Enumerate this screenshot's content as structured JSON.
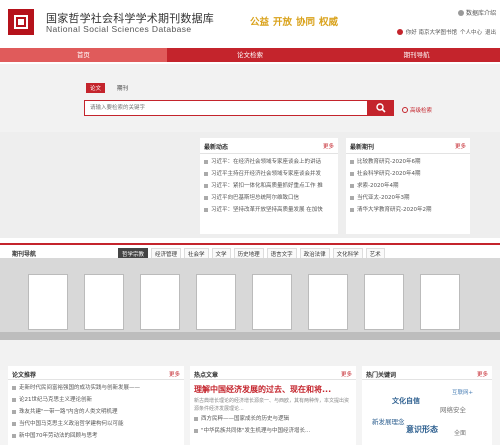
{
  "header": {
    "title_cn": "国家哲学社会科学学术期刊数据库",
    "title_en": "National Social Sciences Database",
    "slogans": [
      "公益",
      "开放",
      "协同",
      "权威"
    ],
    "top_link": "数据库介绍",
    "user_greeting": "你好 南京大学图书馆",
    "personal_center": "个人中心",
    "exit": "退出"
  },
  "nav": {
    "items": [
      "首页",
      "论文检索",
      "期刊导航"
    ]
  },
  "search": {
    "tab_articles": "论文",
    "tab_journals": "期刊",
    "placeholder": "请输入要检索的关键字",
    "advanced": "高级检索"
  },
  "news": {
    "title": "最新动态",
    "more": "更多",
    "items": [
      "习近平：在经济社会领域专家座谈会上的讲话",
      "习近平主持召开经济社会领域专家座谈会并发",
      "习近平：紧扣一体化和高质量抓好重点工作 推",
      "习近平向巴基斯坦总统阿尔维致口信",
      "习近平：坚持改革开放坚持高质量发展 在加快"
    ]
  },
  "journals": {
    "title": "最新期刊",
    "more": "更多",
    "items": [
      "比较教育研究-2020年6期",
      "社会科学研究-2020年4期",
      "求索-2020年4期",
      "当代亚太-2020年3期",
      "清华大学教育研究-2020年2期"
    ]
  },
  "journal_nav": {
    "title": "期刊导航",
    "tabs": [
      "哲学宗教",
      "经济管理",
      "社会学",
      "文学",
      "历史地理",
      "语言文字",
      "政治法律",
      "文化科学",
      "艺术"
    ]
  },
  "recommend": {
    "title": "论文推荐",
    "more": "更多",
    "items": [
      "走新时代民间富裕强国的成功实践与创新发展——",
      "论21世纪马克思主义理论创新",
      "珠友共建\"一带一路\"内含的人类文明机理",
      "当代中国马克思主义政治哲学建构何以可能",
      "新中国70年劳动法的回顾与思考"
    ]
  },
  "hot": {
    "title": "热点文章",
    "more": "更多",
    "feature_title": "理解中国经济发展的过去、现在和将...",
    "feature_text": "新古典增长理论的经济增长源泉一、与西欧，其有两种传，本文提出资源条件经济发展理论...",
    "items": [
      "西方民粹——国家成长的历史与逻辑",
      "\"中华民族共同体\"发生机理与中国经济增长..."
    ]
  },
  "keywords": {
    "title": "热门关键词",
    "more": "更多",
    "tags": [
      "互联网+",
      "文化自信",
      "网络安全",
      "新发展理念",
      "意识形态",
      "全面"
    ]
  },
  "colors": {
    "brand_red": "#c4242c",
    "slogan_gold": "#d9a21b"
  }
}
